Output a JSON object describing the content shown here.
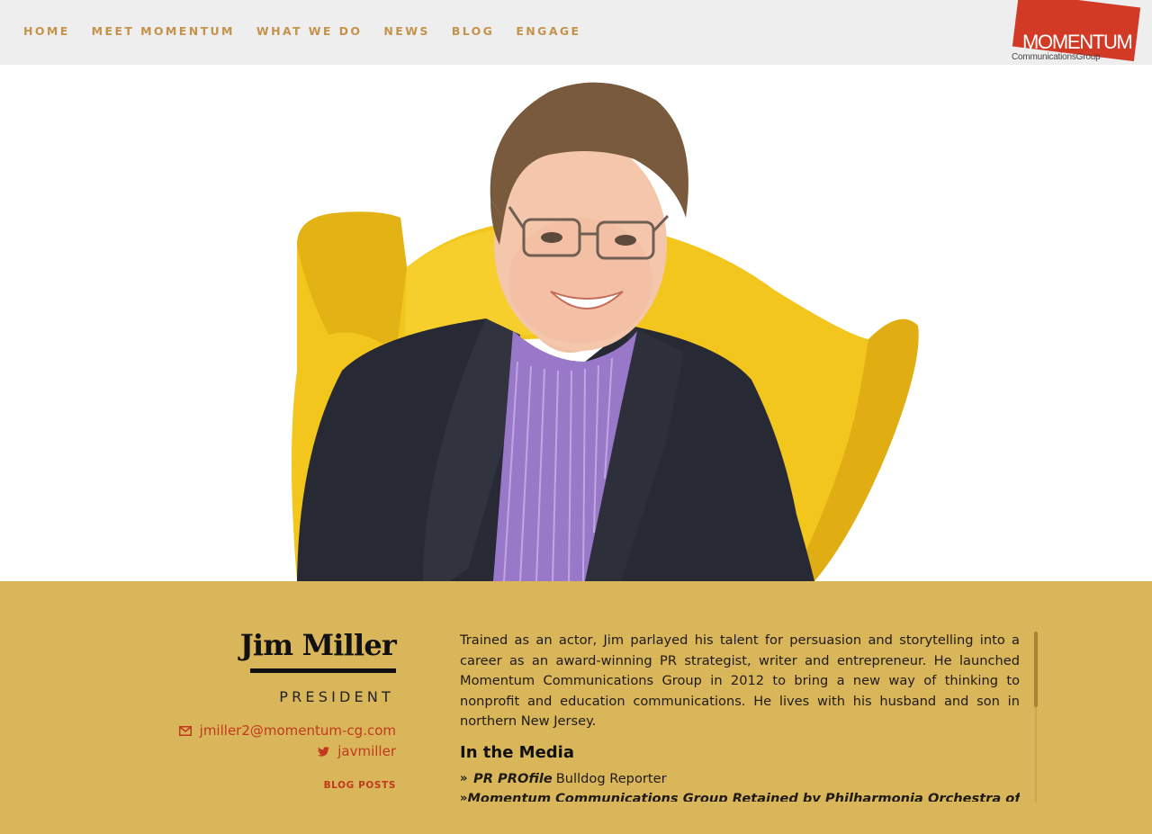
{
  "nav": {
    "items": [
      {
        "label": "HOME"
      },
      {
        "label": "MEET MOMENTUM"
      },
      {
        "label": "WHAT WE DO"
      },
      {
        "label": "NEWS"
      },
      {
        "label": "BLOG"
      },
      {
        "label": "ENGAGE"
      }
    ]
  },
  "logo": {
    "word": "MOMENTUM",
    "sub": "CommunicationsGroup"
  },
  "colors": {
    "nav_text": "#c4924a",
    "logo_red": "#d23a26",
    "bio_band": "#dab65a",
    "accent_red": "#c0391f",
    "chair_yellow": "#f2c61c",
    "suit_navy": "#272935",
    "shirt_purple": "#9a78c9"
  },
  "profile": {
    "name": "Jim Miller",
    "title": "PRESIDENT",
    "email": "jmiller2@momentum-cg.com",
    "twitter": "javmiller",
    "blog_link": "BLOG POSTS",
    "email_icon": "envelope-icon",
    "twitter_icon": "twitter-icon"
  },
  "bio": {
    "text": "Trained as an actor, Jim parlayed his talent for persuasion and storytelling into a career as an award-winning PR strategist, writer and entrepreneur. He launched Momentum Communications Group in 2012 to bring a new way of thinking to nonprofit and education communications. He lives with his husband and son in northern New Jersey.",
    "media_heading": "In the Media",
    "media": [
      {
        "emph": "PR PROfile",
        "rest": "Bulldog Reporter"
      },
      {
        "emph": "Momentum Communications Group Retained by Philharmonia Orchestra of",
        "rest": ""
      }
    ]
  }
}
